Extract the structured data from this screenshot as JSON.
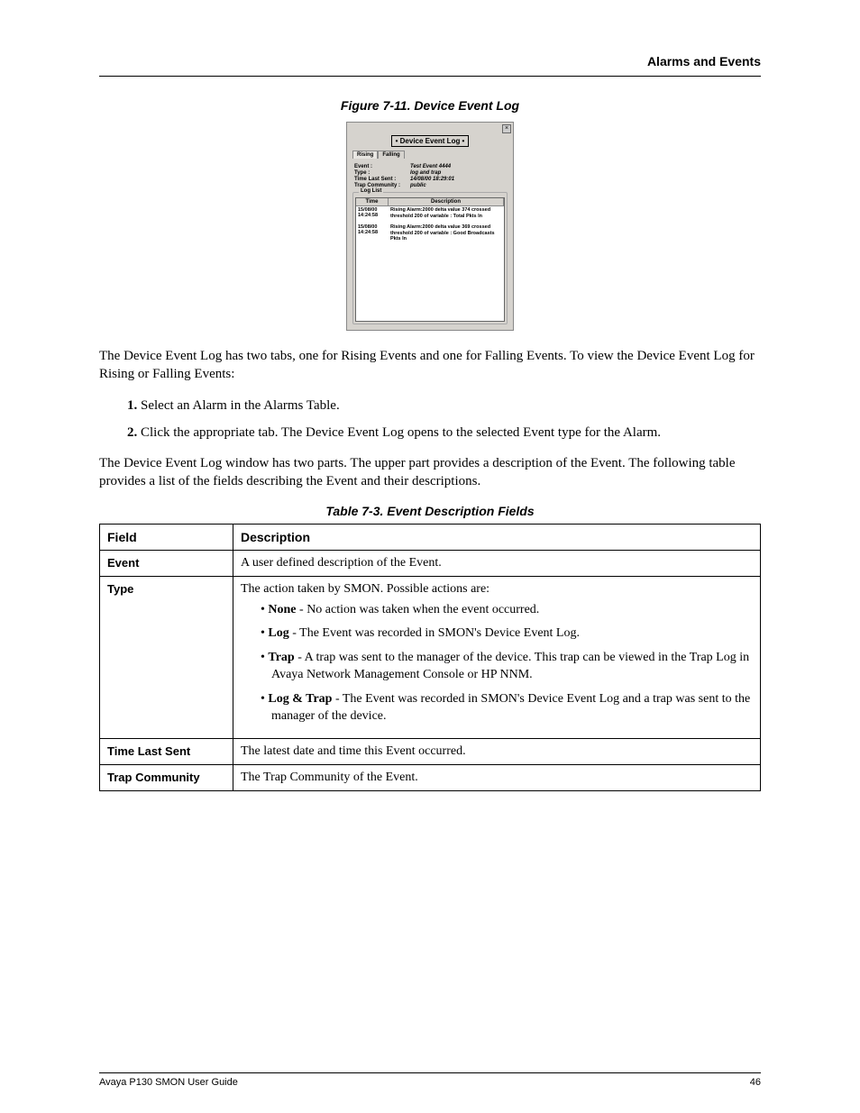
{
  "header": {
    "section": "Alarms and Events"
  },
  "figure": {
    "caption": "Figure 7-11.  Device Event Log",
    "title": "• Device Event Log •",
    "close": "×",
    "tabs": [
      "Rising",
      "Falling"
    ],
    "meta": [
      {
        "label": "Event :",
        "value": "Test Event 4444"
      },
      {
        "label": "Type :",
        "value": "log and trap"
      },
      {
        "label": "Time Last Sent :",
        "value": "14/08/00 18:29:01"
      },
      {
        "label": "Trap Community :",
        "value": "public"
      }
    ],
    "loglist": {
      "legend": "Log List",
      "headers": [
        "Time",
        "Description"
      ],
      "rows": [
        {
          "time": "15/08/00 14:24:58",
          "desc": "Rising Alarm:2000 delta value 374 crossed threshold 200 of variable : Total Pkts In"
        },
        {
          "time": "15/08/00 14:24:58",
          "desc": "Rising Alarm:2000 delta value 369 crossed threshold 200 of variable : Good Broadcasts Pkts In"
        }
      ]
    }
  },
  "para1": "The Device Event Log has two tabs, one for Rising Events and one for Falling Events. To view the Device Event Log for Rising or Falling Events:",
  "steps": [
    "Select an Alarm in the Alarms Table.",
    "Click the appropriate tab. The Device Event Log opens to the selected Event type for the Alarm."
  ],
  "para2": "The Device Event Log window has two parts. The upper part provides a description of the Event. The following table provides a list of the fields describing the Event and their descriptions.",
  "table": {
    "caption": "Table 7-3.  Event Description Fields",
    "headers": [
      "Field",
      "Description"
    ],
    "rows": {
      "event": {
        "field": "Event",
        "desc": "A user defined description of the Event."
      },
      "type": {
        "field": "Type",
        "intro": "The action taken by SMON. Possible actions are:",
        "items": {
          "none": {
            "b": "None",
            "t": " - No action was taken when the event occurred."
          },
          "log": {
            "b": "Log",
            "t": " - The Event was recorded in SMON's Device Event Log."
          },
          "trap": {
            "b": "Trap",
            "t": " - A trap was sent to the manager of the device. This trap can be viewed in the Trap Log in Avaya Network Management Console or HP NNM."
          },
          "logtrap": {
            "b": "Log & Trap",
            "t": " - The Event was recorded in SMON's Device Event Log and a trap was sent to the manager of the device."
          }
        }
      },
      "timelast": {
        "field": "Time Last Sent",
        "desc": "The latest date and time this Event occurred."
      },
      "trapcomm": {
        "field": "Trap Community",
        "desc": "The Trap Community of the Event."
      }
    }
  },
  "footer": {
    "left": "Avaya P130 SMON User Guide",
    "right": "46"
  }
}
